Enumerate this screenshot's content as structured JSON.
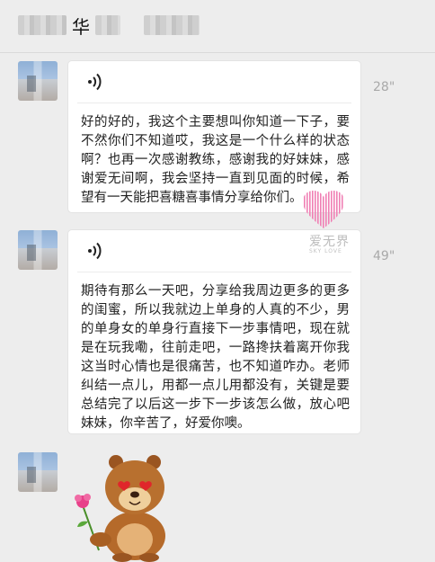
{
  "header": {
    "title_char": "华"
  },
  "messages": [
    {
      "duration": "28\"",
      "text": "好的好的，我这个主要想叫你知道一下子，要不然你们不知道哎，我这是一个什么样的状态啊？也再一次感谢教练，感谢我的好妹妹，感谢爱无间啊，我会坚持一直到见面的时候，希望有一天能把喜糖喜事情分享给你们。"
    },
    {
      "duration": "49\"",
      "text": "期待有那么一天吧，分享给我周边更多的更多的闺蜜，所以我就边上单身的人真的不少，男的单身女的单身行直接下一步事情吧，现在就是在玩我嘞，往前走吧，一路搀扶着离开你我这当时心情也是很痛苦，也不知道咋办。老师纠结一点儿，用都一点儿用都没有，关键是要总结完了以后这一步下一步该怎么做，放心吧妹妹，你辛苦了，好爱你噢。"
    }
  ],
  "watermark": {
    "main": "爱无界",
    "sub": "SKY LOVE"
  },
  "colors": {
    "background": "#ededed",
    "bubble": "#ffffff",
    "duration": "#a9a9a9"
  }
}
